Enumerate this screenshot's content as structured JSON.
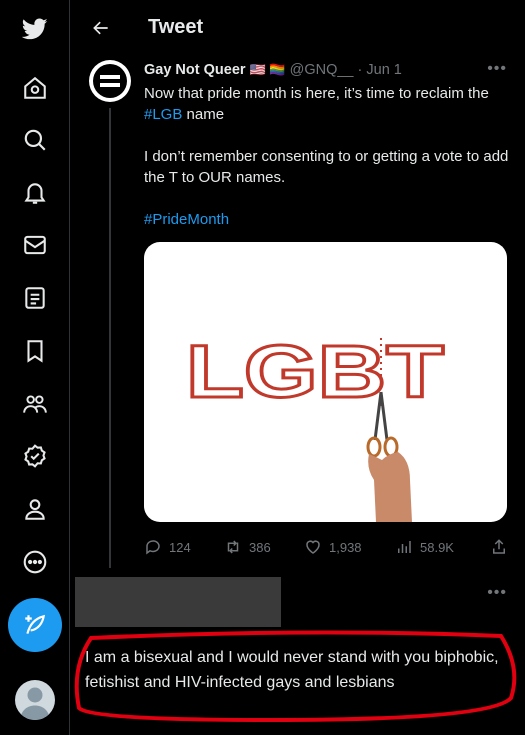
{
  "nav": {
    "items": [
      "twitter-logo",
      "home",
      "explore",
      "notifications",
      "messages",
      "lists",
      "bookmarks",
      "communities",
      "verified",
      "profile",
      "more"
    ]
  },
  "header": {
    "title": "Tweet"
  },
  "tweet": {
    "display_name": "Gay Not Queer",
    "flags": "🇺🇸 🏳️‍🌈",
    "handle": "@GNQ__",
    "separator": "·",
    "date": "Jun 1",
    "text_line1_pre": "Now that pride month is here, it’s time to reclaim the ",
    "hashtag_lgb": "#LGB",
    "text_line1_post": " name",
    "text_para2": "I don’t remember consenting to or getting a vote to add the T to OUR names.",
    "hashtag_pride": "#PrideMonth",
    "media": {
      "letters": "LGBT"
    },
    "stats": {
      "replies": "124",
      "retweets": "386",
      "likes": "1,938",
      "views": "58.9K"
    }
  },
  "reply": {
    "text": "I am a bisexual and I would never stand with you biphobic, fetishist and HIV-infected gays and lesbians"
  },
  "colors": {
    "accent": "#1d9bf0",
    "background": "#000000",
    "annotation": "#e0000f",
    "letter_outline": "#c0392b"
  }
}
